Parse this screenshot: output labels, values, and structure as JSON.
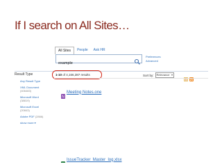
{
  "slide": {
    "title": "If I search on All Sites…"
  },
  "tabs": [
    "All Sites",
    "People",
    "Ask HR"
  ],
  "search": {
    "value": "example",
    "placeholder": ""
  },
  "header_links": {
    "preferences": "Preferences",
    "advanced": "Advanced"
  },
  "refiners": {
    "heading": "Result Type",
    "items": [
      {
        "label": "Any Result Type",
        "count": ""
      },
      {
        "label": "XML Document",
        "count": "(406483)"
      },
      {
        "label": "Microsoft Word",
        "count": "(38819)"
      },
      {
        "label": "Microsoft Excel",
        "count": "(20843)"
      },
      {
        "label": "Adobe PDF",
        "count": "(2866)"
      }
    ],
    "show_more": "show more ▾"
  },
  "results_summary": {
    "range": "1-10",
    "text": "of 4,166,387 results"
  },
  "sort": {
    "label": "Sort by:",
    "selected": "Relevance"
  },
  "results": [
    {
      "title": "Meeting Notes.one",
      "type": "onenote"
    },
    {
      "title": "IssueTracker_Master_log.xlsx",
      "type": "excel"
    }
  ],
  "colors": {
    "title": "#8a2a1f",
    "link": "#2a6ebb",
    "highlight_oval": "#d42a1a",
    "onenote_icon": "#8b4bb0",
    "excel_icon": "#1f7a3c"
  },
  "icons": [
    "search-icon",
    "alert-icon",
    "rss-icon",
    "onenote-icon",
    "excel-icon"
  ]
}
